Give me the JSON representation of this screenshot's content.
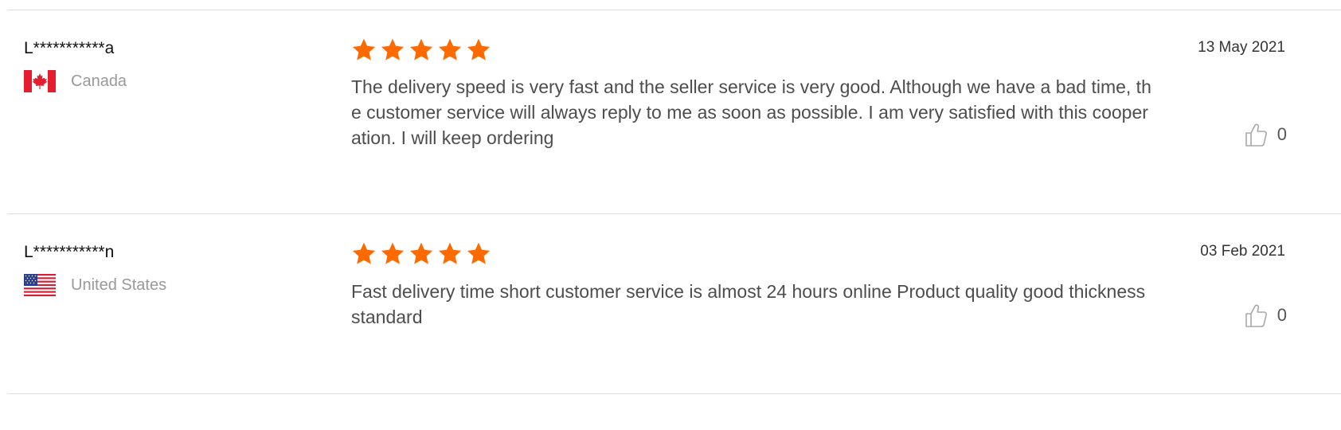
{
  "reviews": [
    {
      "buyer": "L***********a",
      "country": "Canada",
      "flag": "canada-flag",
      "rating": 5,
      "date": "13 May 2021",
      "text": "The delivery speed is very fast and the seller service is very good. Although we have a bad time, the customer service will always reply to me as soon as possible. I am very satisfied with this cooperation. I will keep ordering",
      "helpful_count": "0"
    },
    {
      "buyer": "L***********n",
      "country": "United States",
      "flag": "united-states-flag",
      "rating": 5,
      "date": "03 Feb 2021",
      "text": "Fast delivery time short customer service is almost 24 hours online Product quality good thickness standard",
      "helpful_count": "0"
    }
  ],
  "colors": {
    "star": "#ff6a00",
    "divider": "#dedede",
    "muted_text": "#999999",
    "body_text": "#4d4d4d"
  },
  "icons": {
    "star": "star-icon",
    "helpful": "thumbs-up-icon"
  }
}
